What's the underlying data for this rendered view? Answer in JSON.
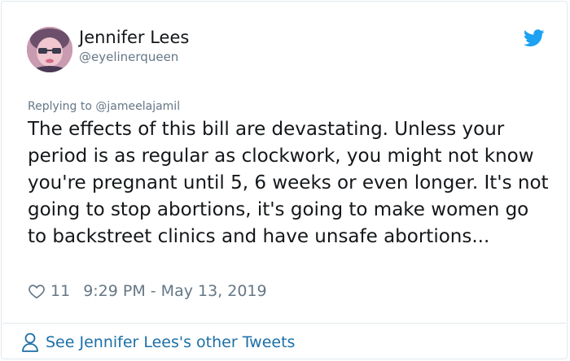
{
  "author": {
    "name": "Jennifer Lees",
    "handle": "@eyelinerqueen",
    "avatar_icon": "user-avatar"
  },
  "brand": {
    "icon": "twitter-bird-icon",
    "color": "#1da1f2"
  },
  "reply": {
    "prefix": "Replying to",
    "mention": "@jameelajamil"
  },
  "tweet": {
    "text": "The effects of this bill are devastating. Unless your period is as regular as clockwork, you might not know you're pregnant until 5, 6 weeks or even longer. It's not going to stop abortions, it's going to make women go to backstreet clinics and have unsafe abortions..."
  },
  "meta": {
    "like_icon": "heart-icon",
    "like_count": "11",
    "timestamp": "9:29 PM - May 13, 2019"
  },
  "footer": {
    "icon": "person-icon",
    "link_label": "See Jennifer Lees's other Tweets",
    "link_color": "#1b6fa8"
  }
}
